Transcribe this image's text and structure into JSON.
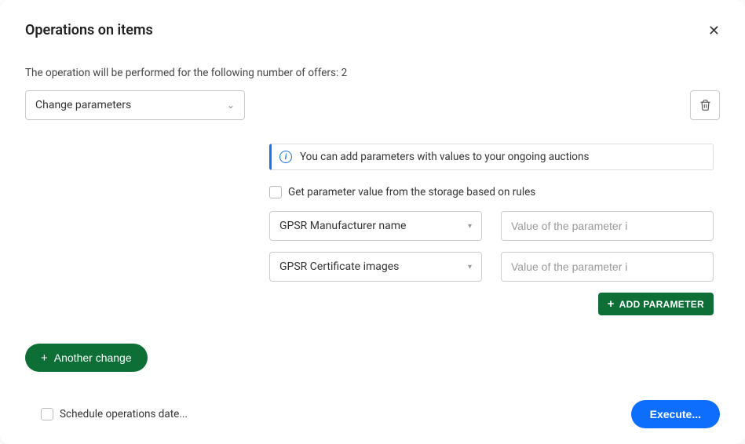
{
  "title": "Operations on items",
  "subtext": "The operation will be performed for the following number of offers: 2",
  "operation_select": "Change parameters",
  "info_text": "You can add parameters with values to your ongoing auctions",
  "checkbox_rules": "Get parameter value from the storage based on rules",
  "param_rows": [
    {
      "name": "GPSR Manufacturer name",
      "placeholder": "Value of the parameter i"
    },
    {
      "name": "GPSR Certificate images",
      "placeholder": "Value of the parameter i"
    }
  ],
  "add_param_label": "ADD PARAMETER",
  "another_change_label": "Another change",
  "schedule_label": "Schedule operations date...",
  "execute_label": "Execute..."
}
